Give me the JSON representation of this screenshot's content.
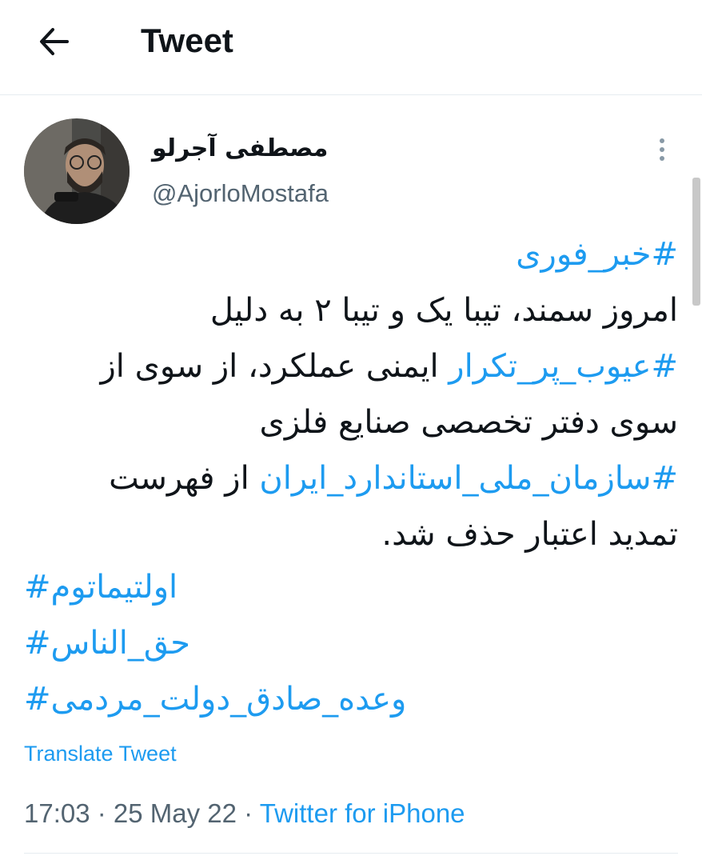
{
  "header": {
    "title": "Tweet"
  },
  "tweet": {
    "display_name": "مصطفی آجرلو",
    "handle": "@AjorloMostafa",
    "body": {
      "line1_hashtag": "#خبر_فوری",
      "line2": "امروز سمند، تیبا یک و تیبا ۲ به دلیل",
      "line3_hashtag": "#عیوب_پر_تکرار",
      "line3_text": " ایمنی عملکرد، از سوی از",
      "line4": "سوی دفتر تخصصی صنایع فلزی",
      "line5_hashtag": "#سازمان_ملی_استاندارد_ایران",
      "line5_text": " از فهرست",
      "line6": "تمدید اعتبار حذف شد."
    },
    "tags": {
      "tag1": "اولتیماتوم#",
      "tag2": "حق_الناس#",
      "tag3": "وعده_صادق_دولت_مردمی#"
    },
    "translate_label": "Translate Tweet",
    "time": "17:03",
    "separator": " · ",
    "date": "25 May 22",
    "source": "Twitter for iPhone"
  },
  "colors": {
    "link": "#1d9bf0",
    "secondary_text": "#536471",
    "text": "#0f1419",
    "divider": "#e6ecf0"
  },
  "icons": {
    "back": "arrow-left-icon",
    "more": "more-vertical-icon"
  }
}
